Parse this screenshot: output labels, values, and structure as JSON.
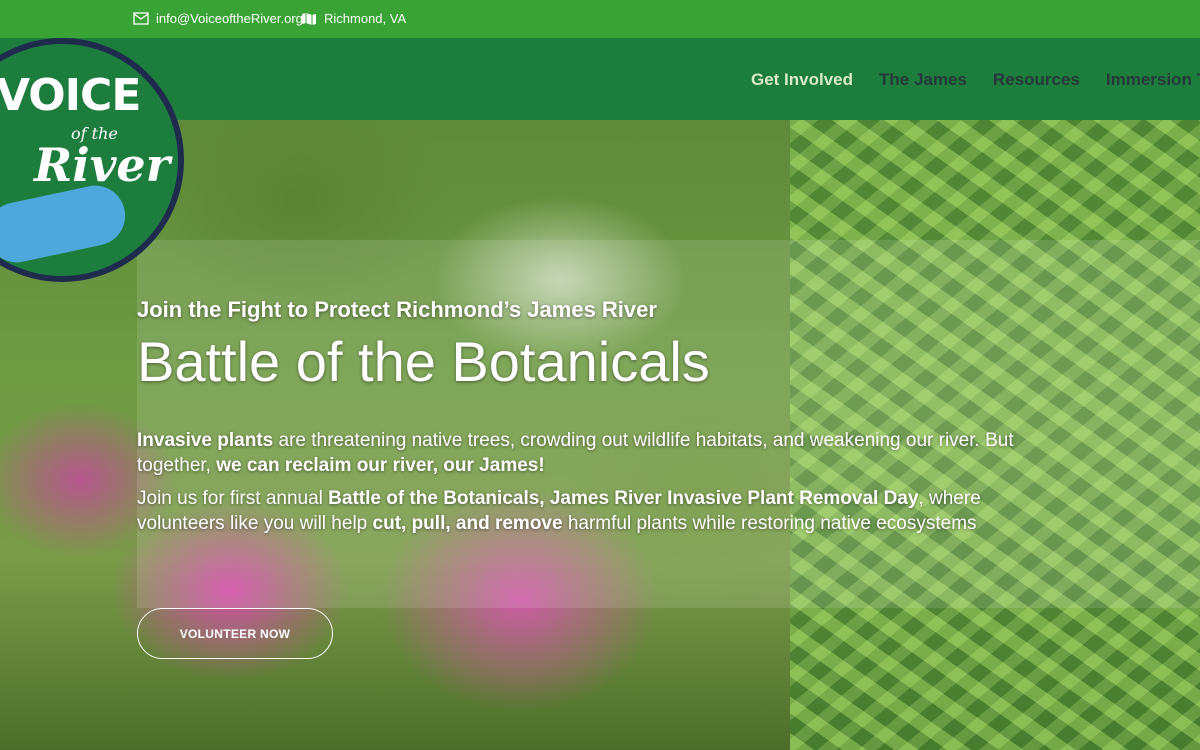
{
  "topbar": {
    "email": "info@VoiceoftheRiver.org",
    "location": "Richmond, VA",
    "email_icon": "envelope-icon",
    "location_icon": "map-icon"
  },
  "logo": {
    "line1": "VOICE",
    "line2": "of the",
    "line3": "River"
  },
  "nav": {
    "items": [
      {
        "label": "Get Involved",
        "active": true
      },
      {
        "label": "The James"
      },
      {
        "label": "Resources"
      },
      {
        "label": "Immersion T"
      }
    ]
  },
  "hero": {
    "kicker": "Join the Fight to Protect Richmond’s James River",
    "title": "Battle of the Botanicals",
    "p1": {
      "b1": "Invasive plants",
      "t1": " are threatening native trees, crowding out wildlife habitats, and weakening our river. But together, ",
      "b2": "we can reclaim our river, our James!"
    },
    "p2": {
      "t1": "Join us for first annual ",
      "b1": "Battle of the Botanicals, James River Invasive Plant Removal Day",
      "t2": ", where volunteers like you will help ",
      "b2": "cut, pull, and remove",
      "t3": " harmful plants while restoring native ecosystems"
    },
    "button_label": "VOLUNTEER NOW"
  },
  "colors": {
    "topbar": "#3aa335",
    "navbar": "#1c7d3d",
    "nav_text": "#27383a",
    "nav_active": "#d8e9c8"
  }
}
